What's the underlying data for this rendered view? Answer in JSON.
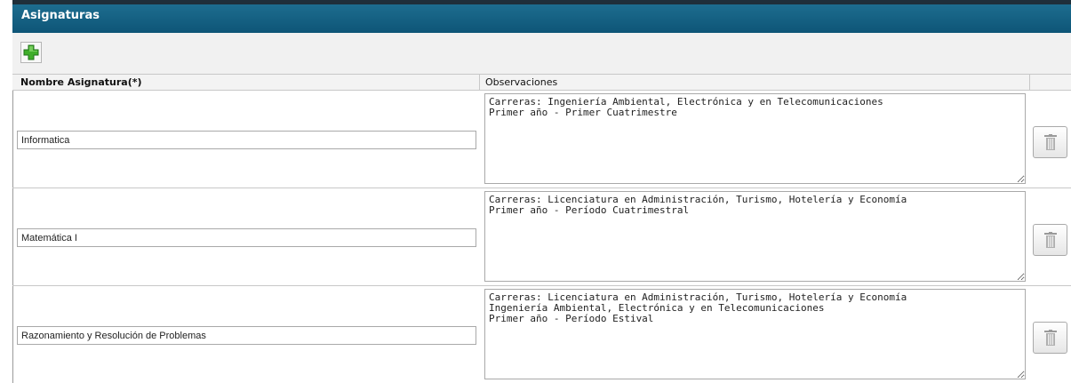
{
  "panel": {
    "title": "Asignaturas",
    "add_icon": "plus-icon"
  },
  "table": {
    "columns": [
      "Nombre Asignatura(*)",
      "Observaciones",
      ""
    ],
    "delete_icon": "trash-icon",
    "rows": [
      {
        "name": "Informatica",
        "observations": "Carreras: Ingeniería Ambiental, Electrónica y en Telecomunicaciones\nPrimer año - Primer Cuatrimestre"
      },
      {
        "name": "Matemática I",
        "observations": "Carreras: Licenciatura en Administración, Turismo, Hotelería y Economía\nPrimer año - Período Cuatrimestral"
      },
      {
        "name": "Razonamiento y Resolución de Problemas",
        "observations": "Carreras: Licenciatura en Administración, Turismo, Hotelería y Economía\nIngeniería Ambiental, Electrónica y en Telecomunicaciones\nPrimer año - Período Estival"
      }
    ]
  }
}
